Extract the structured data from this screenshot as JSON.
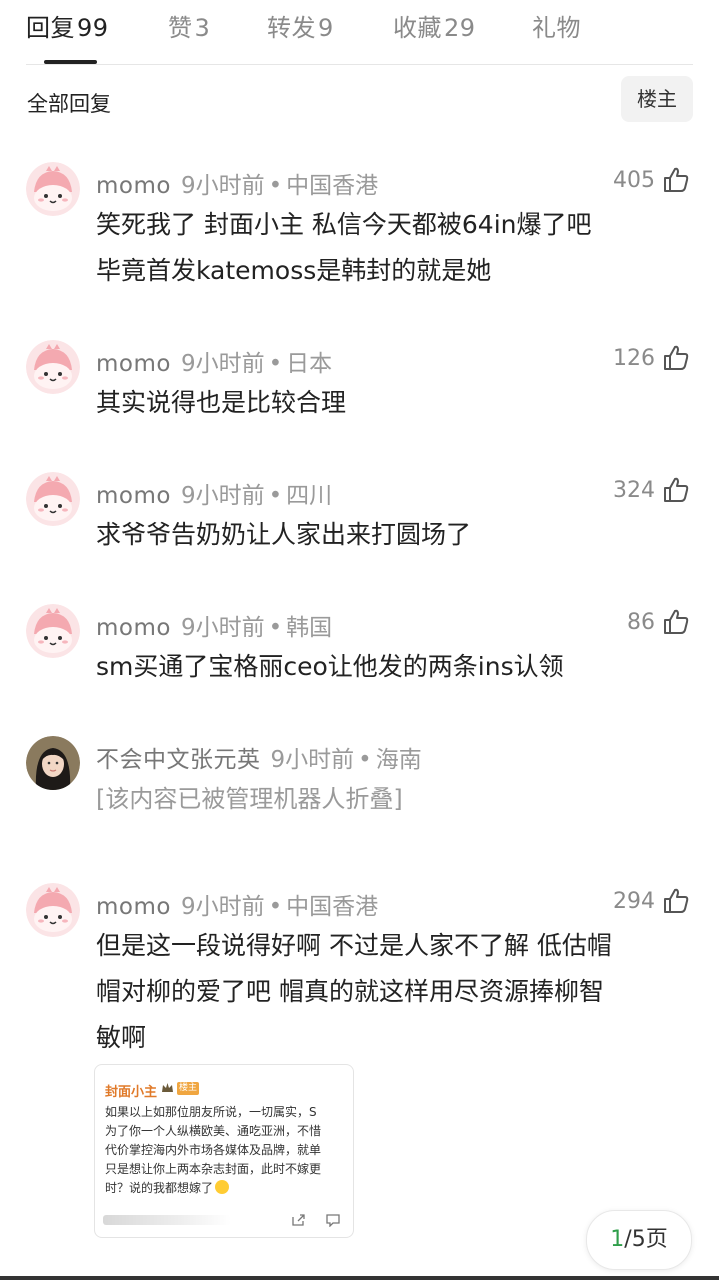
{
  "tabs": [
    {
      "label": "回复",
      "count": "99",
      "active": true
    },
    {
      "label": "赞",
      "count": "3",
      "active": false
    },
    {
      "label": "转发",
      "count": "9",
      "active": false
    },
    {
      "label": "收藏",
      "count": "29",
      "active": false
    },
    {
      "label": "礼物",
      "count": "",
      "active": false
    }
  ],
  "filter": {
    "label": "全部回复",
    "owner_button": "楼主"
  },
  "comments": [
    {
      "user": "momo",
      "time": "9小时前",
      "location": "中国香港",
      "likes": "405",
      "lines": [
        "笑死我了 封面小主 私信今天都被64in爆了吧",
        "毕竟首发katemoss是韩封的就是她"
      ],
      "avatar": "pink-character"
    },
    {
      "user": "momo",
      "time": "9小时前",
      "location": "日本",
      "likes": "126",
      "lines": [
        "其实说得也是比较合理"
      ],
      "avatar": "pink-character"
    },
    {
      "user": "momo",
      "time": "9小时前",
      "location": "四川",
      "likes": "324",
      "lines": [
        "求爷爷告奶奶让人家出来打圆场了"
      ],
      "avatar": "pink-character"
    },
    {
      "user": "momo",
      "time": "9小时前",
      "location": "韩国",
      "likes": "86",
      "lines": [
        "sm买通了宝格丽ceo让他发的两条ins认领"
      ],
      "avatar": "pink-character"
    },
    {
      "user": "不会中文张元英",
      "time": "9小时前",
      "location": "海南",
      "likes": "",
      "lines": [
        "[该内容已被管理机器人折叠]"
      ],
      "avatar": "photo",
      "folded": true
    },
    {
      "user": "momo",
      "time": "9小时前",
      "location": "中国香港",
      "likes": "294",
      "lines": [
        "但是这一段说得好啊 不过是人家不了解 低估帽",
        "帽对柳的爱了吧 帽真的就这样用尽资源捧柳智",
        "敏啊"
      ],
      "avatar": "pink-character"
    }
  ],
  "embed": {
    "author": "封面小主",
    "badge": "楼主",
    "lines": [
      "如果以上如那位朋友所说，一切属实，S",
      "为了你一个人纵横欧美、通吃亚洲，不惜",
      "代价掌控海内外市场各媒体及品牌，就单",
      "只是想让你上两本杂志封面，此时不嫁更",
      "时？说的我都想嫁了"
    ]
  },
  "pager": {
    "current": "1",
    "total_text": "/5页"
  },
  "colors": {
    "accent_green": "#2f9e4a",
    "embed_author": "#e07a2a",
    "muted": "#9a9a9a"
  }
}
